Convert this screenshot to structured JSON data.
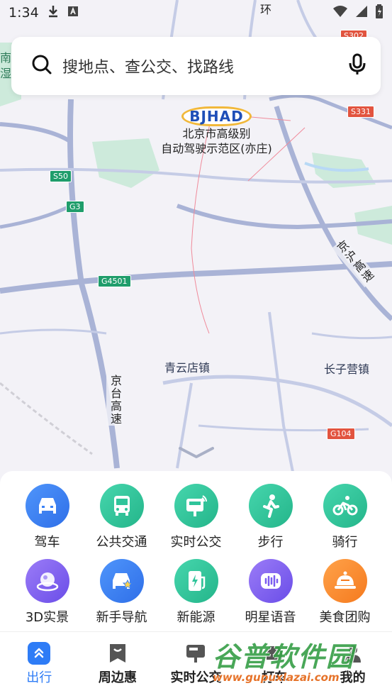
{
  "status": {
    "time": "1:34",
    "download_icon": "download-icon",
    "a_icon": "font-a-icon"
  },
  "search": {
    "placeholder": "搜地点、查公交、找路线"
  },
  "map": {
    "bjhad_logo": "BJHAD",
    "bjhad_line1": "北京市高级别",
    "bjhad_line2": "自动驾驶示范区(亦庄)",
    "labels": {
      "qingyundian": "青云店镇",
      "changziying": "长子营镇",
      "jingtai": "京台高速",
      "jinghu": "京沪高速",
      "huan": "环",
      "nan": "南",
      "shi": "湿"
    },
    "shields": {
      "s50": "S50",
      "g3": "G3",
      "g4501": "G4501",
      "s331": "S331",
      "s302": "S302",
      "g104": "G104"
    }
  },
  "services": [
    {
      "label": "驾车",
      "icon": "car-icon",
      "color": "#3b82f6"
    },
    {
      "label": "公共交通",
      "icon": "bus-icon",
      "color": "#2fc49a"
    },
    {
      "label": "实时公交",
      "icon": "bus-stop-icon",
      "color": "#2fc49a"
    },
    {
      "label": "步行",
      "icon": "walk-icon",
      "color": "#2fc49a"
    },
    {
      "label": "骑行",
      "icon": "bike-icon",
      "color": "#2fc49a"
    },
    {
      "label": "3D实景",
      "icon": "globe-3d-icon",
      "color": "#7b5cf0"
    },
    {
      "label": "新手导航",
      "icon": "new-driver-car-icon",
      "color": "#3b82f6"
    },
    {
      "label": "新能源",
      "icon": "charging-station-icon",
      "color": "#2fc49a"
    },
    {
      "label": "明星语音",
      "icon": "voice-wave-icon",
      "color": "#7b5cf0"
    },
    {
      "label": "美食团购",
      "icon": "food-icon",
      "color": "#fb8a2e"
    }
  ],
  "tabs": [
    {
      "label": "出行",
      "icon": "travel-icon"
    },
    {
      "label": "周边惠",
      "icon": "nearby-deals-icon"
    },
    {
      "label": "实时公交",
      "icon": "realtime-bus-icon"
    },
    {
      "label": "打车",
      "icon": "taxi-icon"
    },
    {
      "label": "我的",
      "icon": "profile-icon"
    }
  ],
  "watermark": {
    "line1": "谷普软件园",
    "line2": "www.gupuxlazai.com"
  }
}
